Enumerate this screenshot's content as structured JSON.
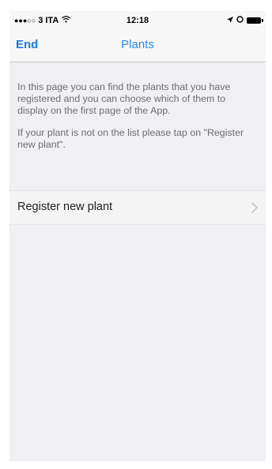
{
  "status_bar": {
    "carrier": "3 ITA",
    "signal_dots": "●●●○○",
    "wifi_icon": "wifi-icon",
    "time": "12:18",
    "location_icon": "location-arrow-icon",
    "alarm_icon": "alarm-icon",
    "battery_icon": "battery-icon"
  },
  "nav": {
    "left_button": "End",
    "title": "Plants"
  },
  "description": {
    "paragraph1": "In this page you can find the plants that you have registered and you can choose which of them to display on the first page of the App.",
    "paragraph2": "If your plant is not on the list please tap on \"Register new plant\"."
  },
  "list": {
    "items": [
      {
        "label": "Register new plant",
        "accessory_icon": "chevron-right-icon"
      }
    ]
  },
  "colors": {
    "accent": "#1a7bd9",
    "background": "#efeff4",
    "secondary_text": "#6d6d72"
  }
}
